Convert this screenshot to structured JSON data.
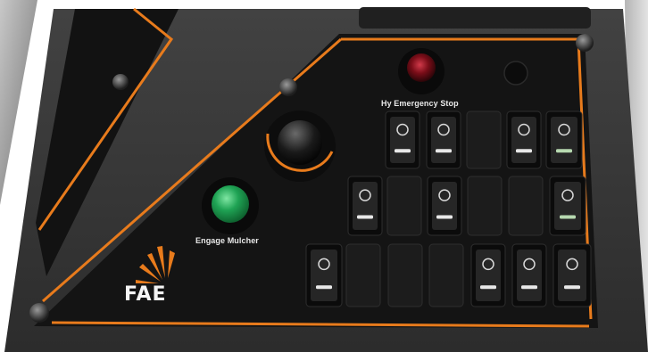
{
  "panel": {
    "emergency_stop_label": "Hy Emergency Stop",
    "engage_mulcher_label": "Engage Mulcher",
    "logo_text": "FAE"
  },
  "colors": {
    "panel_face": "#141414",
    "housing": "#3a3a3a",
    "accent_orange": "#e87b1c",
    "engage_button": "#1fa354",
    "emergency_stop": "#7a0d18"
  },
  "switch_icons": [
    "wiper-washer-front-icon",
    "wiper-washer-rear-icon",
    "work-light-icon",
    "work-light-rear-icon",
    "defrost-icon",
    "wash-nozzle-icon",
    "fan-icon",
    "defrost-rear-icon",
    "fan-low-icon",
    "lock-icon",
    "seat-icon"
  ]
}
